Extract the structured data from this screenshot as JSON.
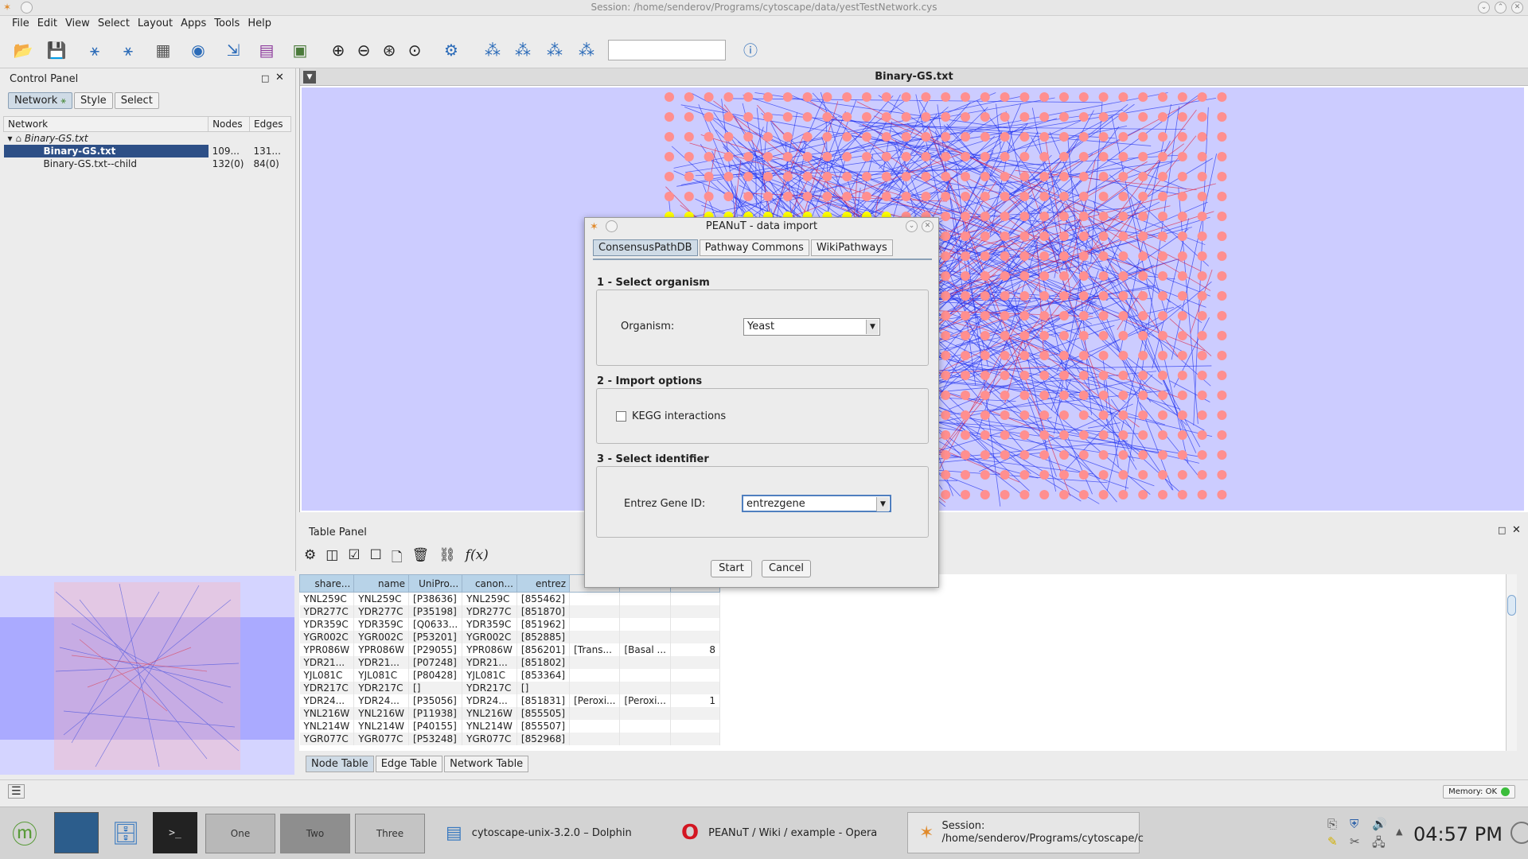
{
  "window": {
    "title": "Session: /home/senderov/Programs/cytoscape/data/yestTestNetwork.cys"
  },
  "menu": [
    "File",
    "Edit",
    "View",
    "Select",
    "Layout",
    "Apps",
    "Tools",
    "Help"
  ],
  "control_panel": {
    "title": "Control Panel",
    "tabs": [
      "Network",
      "Style",
      "Select"
    ],
    "columns": [
      "Network",
      "Nodes",
      "Edges"
    ],
    "rows": [
      {
        "name": "Binary-GS.txt",
        "nodes": "",
        "edges": ""
      },
      {
        "name": "Binary-GS.txt",
        "nodes": "109...",
        "edges": "131..."
      },
      {
        "name": "Binary-GS.txt--child",
        "nodes": "132(0)",
        "edges": "84(0)"
      }
    ]
  },
  "network_view": {
    "title": "Binary-GS.txt"
  },
  "table_panel": {
    "title": "Table Panel",
    "columns": [
      "share...",
      "name",
      "UniPro...",
      "canon...",
      "entrez",
      "",
      "",
      ""
    ],
    "rows": [
      [
        "YNL259C",
        "YNL259C",
        "[P38636]",
        "YNL259C",
        "[855462]",
        "",
        "",
        ""
      ],
      [
        "YDR277C",
        "YDR277C",
        "[P35198]",
        "YDR277C",
        "[851870]",
        "",
        "",
        ""
      ],
      [
        "YDR359C",
        "YDR359C",
        "[Q0633...",
        "YDR359C",
        "[851962]",
        "",
        "",
        ""
      ],
      [
        "YGR002C",
        "YGR002C",
        "[P53201]",
        "YGR002C",
        "[852885]",
        "",
        "",
        ""
      ],
      [
        "YPR086W",
        "YPR086W",
        "[P29055]",
        "YPR086W",
        "[856201]",
        "[Trans...",
        "[Basal ...",
        "8"
      ],
      [
        "YDR21...",
        "YDR21...",
        "[P07248]",
        "YDR21...",
        "[851802]",
        "",
        "",
        ""
      ],
      [
        "YJL081C",
        "YJL081C",
        "[P80428]",
        "YJL081C",
        "[853364]",
        "",
        "",
        ""
      ],
      [
        "YDR217C",
        "YDR217C",
        "[]",
        "YDR217C",
        "[]",
        "",
        "",
        ""
      ],
      [
        "YDR24...",
        "YDR24...",
        "[P35056]",
        "YDR24...",
        "[851831]",
        "[Peroxi...",
        "[Peroxi...",
        "1"
      ],
      [
        "YNL216W",
        "YNL216W",
        "[P11938]",
        "YNL216W",
        "[855505]",
        "",
        "",
        ""
      ],
      [
        "YNL214W",
        "YNL214W",
        "[P40155]",
        "YNL214W",
        "[855507]",
        "",
        "",
        ""
      ],
      [
        "YGR077C",
        "YGR077C",
        "[P53248]",
        "YGR077C",
        "[852968]",
        "",
        "",
        ""
      ]
    ],
    "bottom_tabs": [
      "Node Table",
      "Edge Table",
      "Network Table"
    ]
  },
  "status": {
    "memory": "Memory: OK"
  },
  "dialog": {
    "title": "PEANuT - data import",
    "tabs": [
      "ConsensusPathDB",
      "Pathway Commons",
      "WikiPathways"
    ],
    "sec1": "1 - Select organism",
    "organism_label": "Organism:",
    "organism_value": "Yeast",
    "sec2": "2 - Import options",
    "kegg_label": "KEGG interactions",
    "sec3": "3 - Select identifier",
    "id_label": "Entrez Gene ID:",
    "id_value": "entrezgene",
    "start": "Start",
    "cancel": "Cancel"
  },
  "taskbar": {
    "workspaces": [
      "One",
      "Two",
      "Three"
    ],
    "tasks": [
      "cytoscape-unix-3.2.0 – Dolphin",
      "PEANuT / Wiki / example - Opera"
    ],
    "session_line1": "Session:",
    "session_line2": "/home/senderov/Programs/cytoscape/c",
    "clock": "04:57 PM"
  }
}
